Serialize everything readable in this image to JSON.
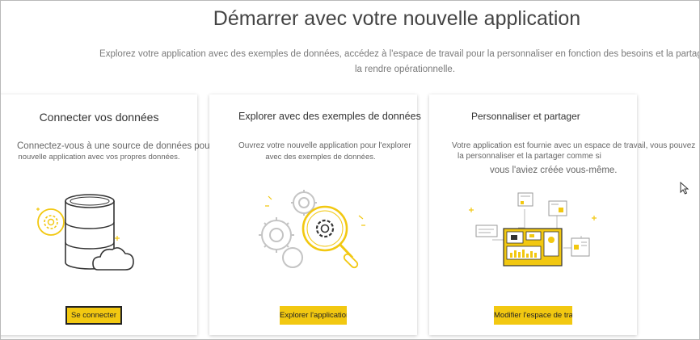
{
  "page": {
    "title": "Démarrer avec votre nouvelle application",
    "intro_line1": "Explorez votre application avec des exemples de données, accédez à l'espace de travail pour la personnaliser en fonction des besoins et la partager",
    "intro_line2": "la rendre opérationnelle."
  },
  "cards": [
    {
      "title": "Connecter vos données",
      "desc_line1": "Connectez-vous à une source de données pour votre",
      "desc_line2": "nouvelle application avec vos propres données.",
      "button_label": "Se connecter",
      "icon": "database-cloud-gear-icon"
    },
    {
      "title": "Explorer avec des exemples de données",
      "desc_line1": "Ouvrez votre nouvelle application pour l'explorer",
      "desc_line2": "avec des exemples de données.",
      "button_label": "Explorer l'application",
      "icon": "gears-magnifier-icon"
    },
    {
      "title": "Personnaliser et partager",
      "desc_line1": "Votre application est fournie avec un espace de travail, vous pouvez",
      "desc_line2": "la personnaliser et la partager comme si",
      "desc_line3": "vous l'aviez créée vous-même.",
      "button_label": "Modifier l'espace de travail",
      "icon": "dashboard-share-icon"
    }
  ],
  "colors": {
    "accent": "#f2c811",
    "line_gray": "#b8b8b8",
    "text_dark": "#333333"
  }
}
